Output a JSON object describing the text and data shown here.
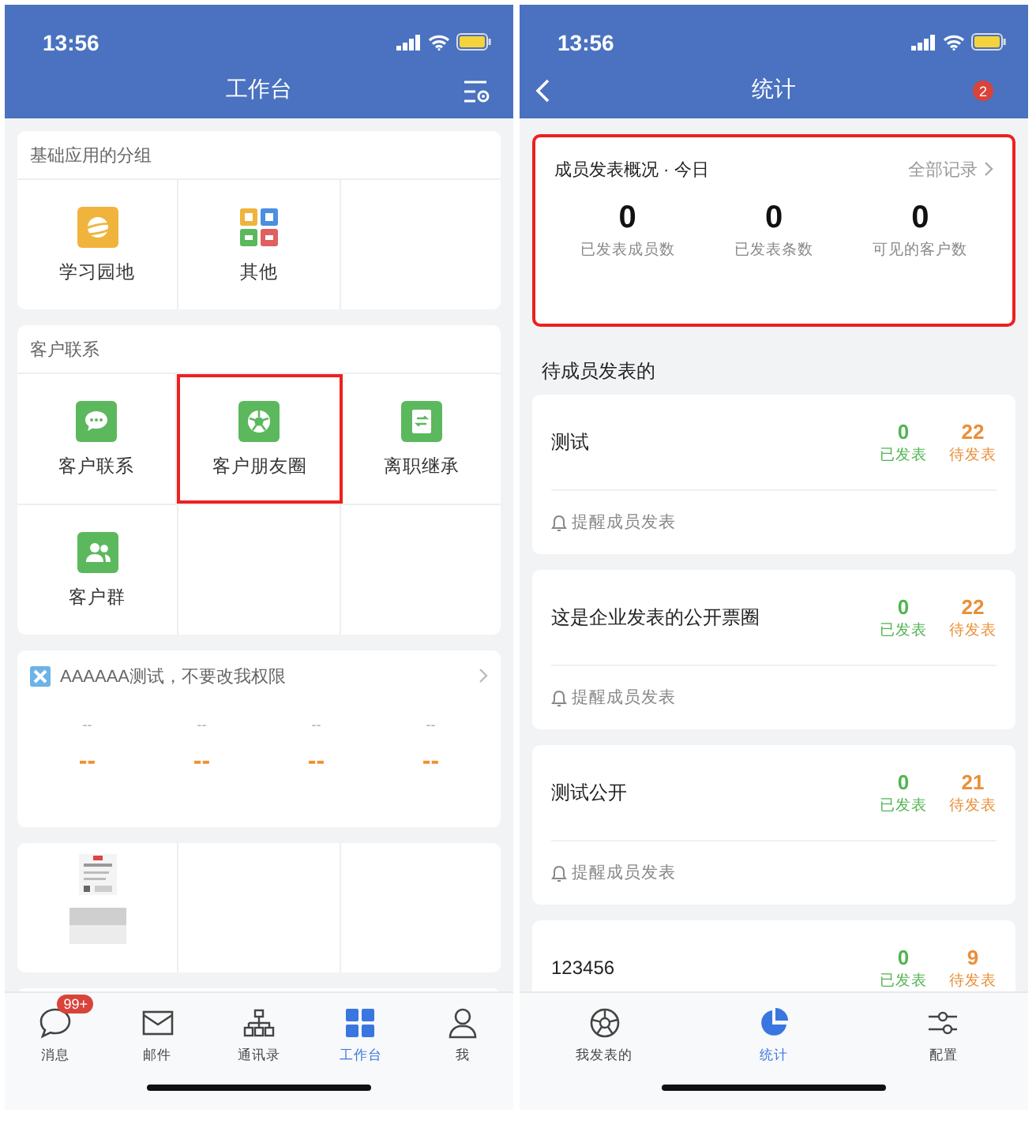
{
  "workbench": {
    "status_bar": {
      "time": "13:56"
    },
    "title": "工作台",
    "groups": [
      {
        "title": "基础应用的分组",
        "apps": [
          {
            "label": "学习园地",
            "highlighted": false
          },
          {
            "label": "其他",
            "highlighted": false
          }
        ]
      },
      {
        "title": "客户联系",
        "apps": [
          {
            "label": "客户联系",
            "highlighted": false
          },
          {
            "label": "客户朋友圈",
            "highlighted": true
          },
          {
            "label": "离职继承",
            "highlighted": false
          },
          {
            "label": "客户群",
            "highlighted": false
          }
        ]
      }
    ],
    "report": {
      "title": "AAAAAA测试，不要改我权限",
      "metrics": [
        {
          "label": "--",
          "value": "--"
        },
        {
          "label": "--",
          "value": "--"
        },
        {
          "label": "--",
          "value": "--"
        },
        {
          "label": "--",
          "value": "--"
        }
      ]
    },
    "media_tiles": [
      {
        "kind": "picture"
      },
      {
        "kind": "empty"
      },
      {
        "kind": "empty"
      }
    ],
    "tab_bar": [
      {
        "label": "消息",
        "selected": false,
        "badge": "99+"
      },
      {
        "label": "邮件",
        "selected": false
      },
      {
        "label": "通讯录",
        "selected": false
      },
      {
        "label": "工作台",
        "selected": true
      },
      {
        "label": "我",
        "selected": false
      }
    ]
  },
  "stats": {
    "status_bar": {
      "time": "13:56"
    },
    "title": "统计",
    "badge": "2",
    "overview": {
      "title": "成员发表概况 · 今日",
      "link": "全部记录",
      "highlighted": true,
      "figures": [
        {
          "value": "0",
          "label": "已发表成员数"
        },
        {
          "value": "0",
          "label": "已发表条数"
        },
        {
          "value": "0",
          "label": "可见的客户数"
        }
      ]
    },
    "section_title": "待成员发表的",
    "posts": [
      {
        "title": "测试",
        "published": "0",
        "published_label": "已发表",
        "pending": "22",
        "pending_label": "待发表",
        "remind": "提醒成员发表"
      },
      {
        "title": "这是企业发表的公开票圈",
        "published": "0",
        "published_label": "已发表",
        "pending": "22",
        "pending_label": "待发表",
        "remind": "提醒成员发表"
      },
      {
        "title": "测试公开",
        "published": "0",
        "published_label": "已发表",
        "pending": "21",
        "pending_label": "待发表",
        "remind": "提醒成员发表"
      },
      {
        "title": "123456",
        "published": "0",
        "published_label": "已发表",
        "pending": "9",
        "pending_label": "待发表"
      }
    ],
    "tab_bar": [
      {
        "label": "我发表的",
        "selected": false
      },
      {
        "label": "统计",
        "selected": true
      },
      {
        "label": "配置",
        "selected": false
      }
    ]
  }
}
